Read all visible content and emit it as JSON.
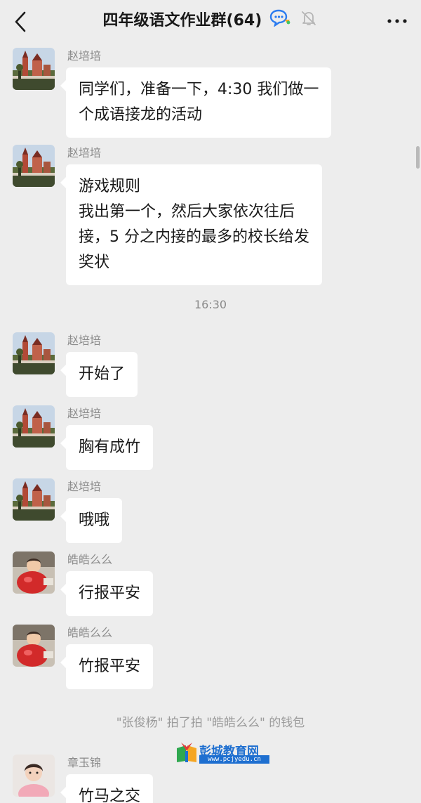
{
  "header": {
    "title": "四年级语文作业群(64)",
    "back_icon": "chevron-left-icon",
    "more_icon": "more-dots-icon"
  },
  "messages": [
    {
      "sender": "赵培培",
      "lines": [
        "同学们，准备一下，4:30 我们做一",
        "个成语接龙的活动"
      ],
      "avatar": "castle-photo"
    },
    {
      "sender": "赵培培",
      "lines": [
        "游戏规则",
        "我出第一个，然后大家依次往后",
        "接，5 分之内接的最多的校长给发",
        "奖状"
      ],
      "avatar": "castle-photo"
    },
    {
      "sender": "赵培培",
      "lines": [
        "开始了"
      ],
      "avatar": "castle-photo"
    },
    {
      "sender": "赵培培",
      "lines": [
        "胸有成竹"
      ],
      "avatar": "castle-photo"
    },
    {
      "sender": "赵培培",
      "lines": [
        "哦哦"
      ],
      "avatar": "castle-photo"
    },
    {
      "sender": "皓皓么么",
      "lines": [
        "行报平安"
      ],
      "avatar": "child-red-photo"
    },
    {
      "sender": "皓皓么么",
      "lines": [
        "竹报平安"
      ],
      "avatar": "child-red-photo"
    },
    {
      "sender": "章玉锦",
      "lines": [
        "竹马之交"
      ],
      "avatar": "child-pink-photo"
    }
  ],
  "timestamp": "16:30",
  "system_notice": "\"张俊杨\" 拍了拍 \"皓皓么么\" 的钱包",
  "watermark": {
    "name": "彭城教育网",
    "url": "www.pcjyedu.cn"
  }
}
